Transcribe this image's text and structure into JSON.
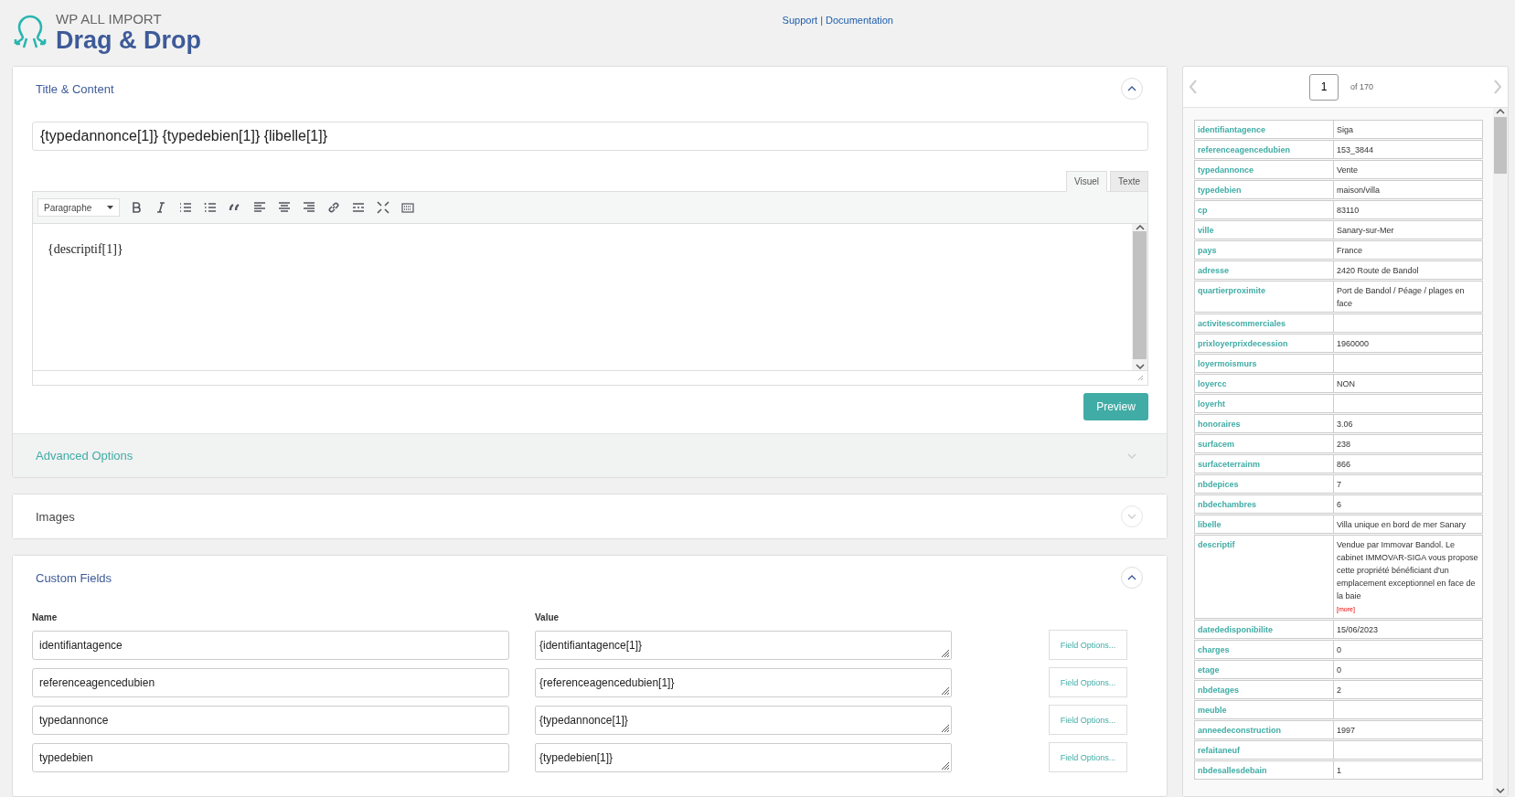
{
  "header": {
    "brand": "WP ALL IMPORT",
    "title": "Drag & Drop",
    "links": [
      "Support",
      "Documentation"
    ],
    "separator": "|"
  },
  "title_content": {
    "heading": "Title & Content",
    "expanded": true,
    "title_value": "{typedannonce[1]} {typedebien[1]} {libelle[1]}",
    "editor": {
      "tabs": [
        {
          "label": "Visuel",
          "selected": true
        },
        {
          "label": "Texte",
          "selected": false
        }
      ],
      "format": "Paragraphe",
      "content": "{descriptif[1]}"
    },
    "preview_button": "Preview"
  },
  "advanced_options": {
    "heading": "Advanced Options",
    "expanded": false
  },
  "images": {
    "heading": "Images",
    "expanded": false
  },
  "custom_fields": {
    "heading": "Custom Fields",
    "expanded": true,
    "name_header": "Name",
    "value_header": "Value",
    "rows": [
      {
        "name": "identifiantagence",
        "value": "{identifiantagence[1]}",
        "button": "Field Options..."
      },
      {
        "name": "referenceagencedubien",
        "value": "{referenceagencedubien[1]}",
        "button": "Field Options..."
      },
      {
        "name": "typedannonce",
        "value": "{typedannonce[1]}",
        "button": "Field Options..."
      },
      {
        "name": "typedebien",
        "value": "{typedebien[1]}",
        "button": "Field Options..."
      }
    ]
  },
  "record_preview": {
    "page": "1",
    "of": "of 170",
    "rows": [
      {
        "key": "identifiantagence",
        "value": "Siga"
      },
      {
        "key": "referenceagencedubien",
        "value": "153_3844"
      },
      {
        "key": "typedannonce",
        "value": "Vente"
      },
      {
        "key": "typedebien",
        "value": "maison/villa"
      },
      {
        "key": "cp",
        "value": "83110"
      },
      {
        "key": "ville",
        "value": "Sanary-sur-Mer"
      },
      {
        "key": "pays",
        "value": "France"
      },
      {
        "key": "adresse",
        "value": "2420 Route de Bandol"
      },
      {
        "key": "quartierproximite",
        "value": "Port de Bandol / Péage / plages en face"
      },
      {
        "key": "activitescommerciales"
      },
      {
        "key": "prixloyerprixdecession",
        "value": "1960000"
      },
      {
        "key": "loyermoismurs"
      },
      {
        "key": "loyercc",
        "value": "NON"
      },
      {
        "key": "loyerht"
      },
      {
        "key": "honoraires",
        "value": "3.06"
      },
      {
        "key": "surfacem",
        "value": "238"
      },
      {
        "key": "surfaceterrainm",
        "value": "866"
      },
      {
        "key": "nbdepices",
        "value": "7"
      },
      {
        "key": "nbdechambres",
        "value": "6"
      },
      {
        "key": "libelle",
        "value": "Villa unique en bord de mer Sanary"
      },
      {
        "key": "descriptif",
        "value": "Vendue par Immovar Bandol. Le cabinet IMMOVAR-SIGA vous propose cette propriété bénéficiant d'un emplacement exceptionnel en face de la baie",
        "more": "[more]"
      },
      {
        "key": "datededisponibilite",
        "value": "15/06/2023"
      },
      {
        "key": "charges",
        "value": "0"
      },
      {
        "key": "etage",
        "value": "0"
      },
      {
        "key": "nbdetages",
        "value": "2"
      },
      {
        "key": "meuble"
      },
      {
        "key": "anneedeconstruction",
        "value": "1997"
      },
      {
        "key": "refaitaneuf"
      },
      {
        "key": "nbdesallesdebain",
        "value": "1"
      }
    ]
  }
}
